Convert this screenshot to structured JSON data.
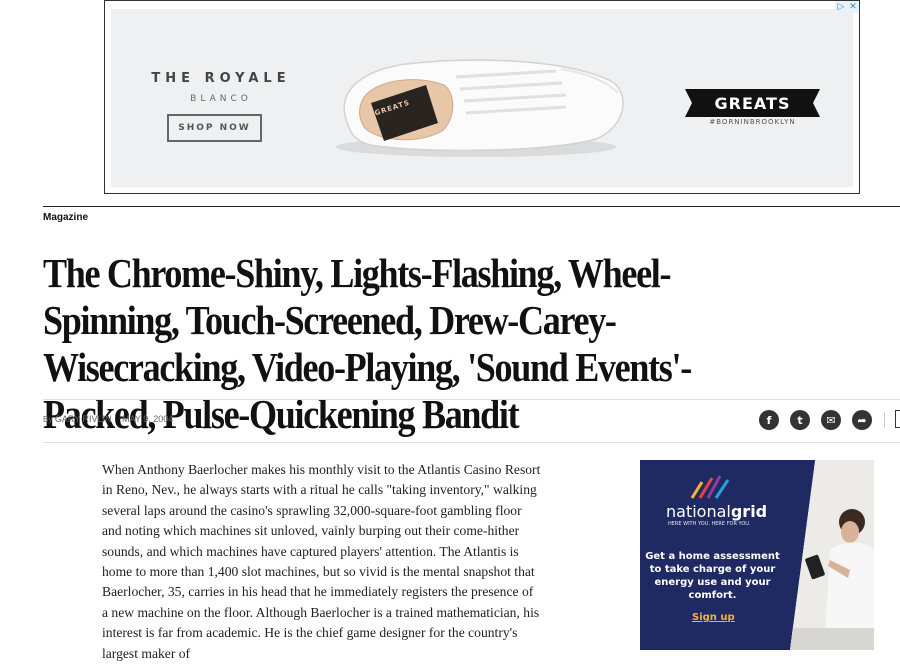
{
  "top_ad": {
    "brand_line1": "THE ROYALE",
    "brand_line2": "BLANCO",
    "cta": "SHOP NOW",
    "logo": "GREATS",
    "tagline": "#BORNINBROOKLYN",
    "shoe_label": "GREATS",
    "adchoice_icons": [
      "adchoices-icon",
      "close-icon"
    ]
  },
  "article": {
    "section": "Magazine",
    "headline": "The Chrome-Shiny, Lights-Flashing, Wheel-Spinning, Touch-Screened, Drew-Carey-Wisecracking, Video-Playing, 'Sound Events'- Packed, Pulse-Quickening Bandit",
    "byline_prefix": "By",
    "author": "GARY RIVLIN",
    "date": "MAY 9, 2004",
    "body": "When Anthony Baerlocher makes his monthly visit to the Atlantis Casino Resort in Reno, Nev., he always starts with a ritual he calls \"taking inventory,\" walking several laps around the casino's sprawling 32,000-square-foot gambling floor and noting which machines sit unloved, vainly burping out their come-hither sounds, and which machines have captured players' attention. The Atlantis is home to more than 1,400 slot machines, but so vivid is the mental snapshot that Baerlocher, 35, carries in his head that he immediately registers the presence of a new machine on the floor. Although Baerlocher is a trained mathematician, his interest is far from academic. He is the chief game designer for the country's largest maker of"
  },
  "share": [
    {
      "icon": "facebook-icon",
      "glyph": "f"
    },
    {
      "icon": "twitter-icon",
      "glyph": "t"
    },
    {
      "icon": "email-icon",
      "glyph": "✉"
    },
    {
      "icon": "share-icon",
      "glyph": "➦"
    }
  ],
  "side_ad": {
    "brand_light": "national",
    "brand_bold": "grid",
    "tagline": "HERE WITH YOU. HERE FOR YOU.",
    "copy": "Get a home assessment to take charge of your energy use and your comfort.",
    "cta": "Sign up"
  },
  "colors": {
    "side_ad_bg": "#1f2a63",
    "signup": "#f5b335",
    "share_buttons": "#333333"
  }
}
